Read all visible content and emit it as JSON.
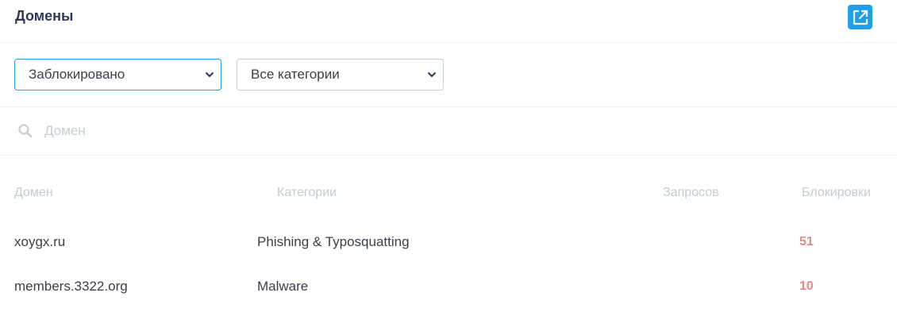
{
  "header": {
    "title": "Домены",
    "open_external_icon": "external-link-icon"
  },
  "filters": {
    "status": {
      "value": "Заблокировано"
    },
    "category": {
      "value": "Все категории"
    }
  },
  "search": {
    "placeholder": "Домен",
    "icon": "search-icon"
  },
  "table": {
    "columns": [
      "Домен",
      "Категории",
      "Запросов",
      "Блокировки"
    ],
    "rows": [
      {
        "domain": "xoygx.ru",
        "category": "Phishing & Typosquatting",
        "requests": "",
        "blocks": "51"
      },
      {
        "domain": "members.3322.org",
        "category": "Malware",
        "requests": "",
        "blocks": "10"
      }
    ]
  },
  "colors": {
    "accent": "#1f9fe8",
    "block_count": "#e08b8b",
    "muted": "#c3cbd6"
  }
}
